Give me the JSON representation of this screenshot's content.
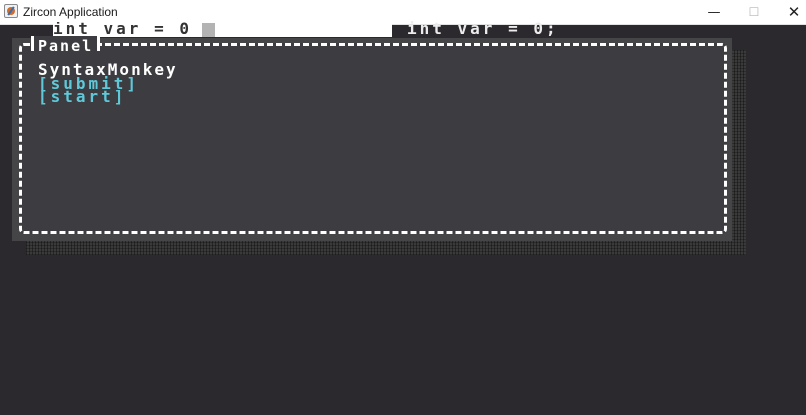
{
  "window": {
    "title": "Zircon Application",
    "icon": "java-app-icon",
    "controls": {
      "minimize_glyph": "—",
      "maximize_glyph": "☐",
      "close_glyph": "✕"
    }
  },
  "editor": {
    "text_area_value": "int var = 0",
    "code_label": "int var = 0;"
  },
  "panel": {
    "title": "Panel",
    "label": "SyntaxMonkey",
    "buttons": [
      {
        "label": "[submit]"
      },
      {
        "label": "[start]"
      }
    ]
  },
  "colors": {
    "background": "#2b292d",
    "panel": "#3d3c40",
    "border": "#ffffff",
    "button_text": "#5fc9d9",
    "label_text": "#ffffff"
  }
}
